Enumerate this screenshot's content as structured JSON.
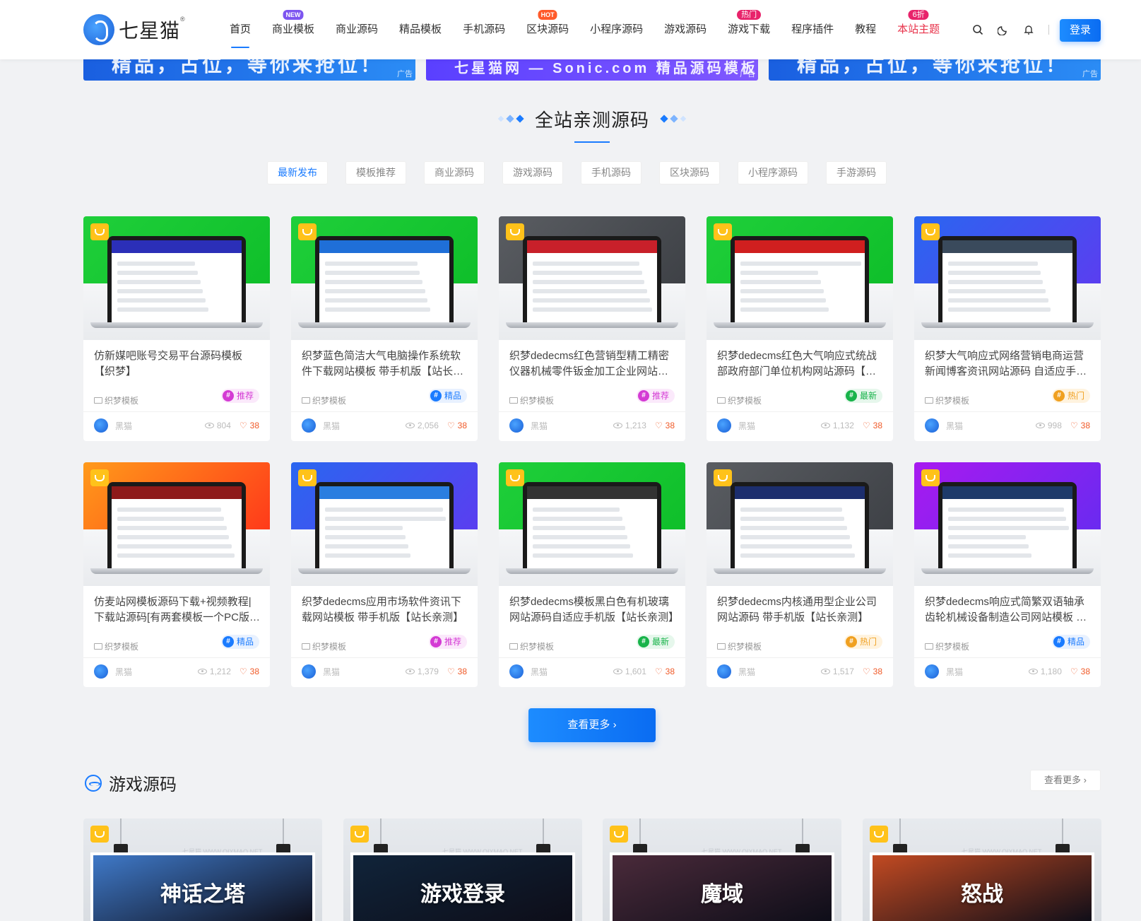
{
  "header": {
    "logo_text": "七星猫",
    "logo_reg": "®",
    "nav": [
      {
        "label": "首页",
        "badge": "",
        "active": true
      },
      {
        "label": "商业模板",
        "badge": "NEW",
        "badge_type": "new"
      },
      {
        "label": "商业源码",
        "badge": ""
      },
      {
        "label": "精品模板",
        "badge": ""
      },
      {
        "label": "手机源码",
        "badge": ""
      },
      {
        "label": "区块源码",
        "badge": "HOT",
        "badge_type": "hot"
      },
      {
        "label": "小程序源码",
        "badge": ""
      },
      {
        "label": "游戏源码",
        "badge": ""
      },
      {
        "label": "游戏下载",
        "badge": "热门",
        "badge_type": "pink"
      },
      {
        "label": "程序插件",
        "badge": ""
      },
      {
        "label": "教程",
        "badge": ""
      },
      {
        "label": "本站主题",
        "badge": "6折",
        "badge_type": "pink",
        "red": true
      }
    ],
    "icons": [
      "search-icon",
      "moon-icon",
      "bell-icon"
    ],
    "login_label": "登录"
  },
  "ads": [
    {
      "text": "精品，占位，等你来抢位！",
      "tag": "广告"
    },
    {
      "text": "七星猫网 — Sonic.com 精品源码模板",
      "tag": "广告"
    },
    {
      "text": "精品，占位，等你来抢位！",
      "tag": "广告"
    }
  ],
  "section": {
    "title": "全站亲测源码",
    "tabs": [
      "最新发布",
      "模板推荐",
      "商业源码",
      "游戏源码",
      "手机源码",
      "区块源码",
      "小程序源码",
      "手游源码"
    ]
  },
  "cards": [
    {
      "title": "仿新媒吧账号交易平台源码模板【织梦】",
      "category": "织梦模板",
      "tag": "推荐",
      "author": "黑猫",
      "views": "804",
      "likes": "38",
      "theme": "green",
      "screen": "#2b2fb8"
    },
    {
      "title": "织梦蓝色简洁大气电脑操作系统软件下载网站模板 带手机版【站长亲测】",
      "category": "织梦模板",
      "tag": "精品",
      "author": "黑猫",
      "views": "2,056",
      "likes": "38",
      "theme": "green",
      "screen": "#1f6fd8"
    },
    {
      "title": "织梦dedecms红色营销型精工精密仪器机械零件钣金加工企业网站模板",
      "category": "织梦模板",
      "tag": "推荐",
      "author": "黑猫",
      "views": "1,213",
      "likes": "38",
      "theme": "gray",
      "screen": "#c8202a"
    },
    {
      "title": "织梦dedecms红色大气响应式统战部政府部门单位机构网站源码【站长亲测】",
      "category": "织梦模板",
      "tag": "最新",
      "author": "黑猫",
      "views": "1,132",
      "likes": "38",
      "theme": "green",
      "screen": "#d01f1f"
    },
    {
      "title": "织梦大气响应式网络营销电商运营新闻博客资讯网站源码 自适应手机版",
      "category": "织梦模板",
      "tag": "热门",
      "author": "黑猫",
      "views": "998",
      "likes": "38",
      "theme": "blue",
      "screen": "#3a4a5c"
    },
    {
      "title": "仿麦站网模板源码下载+视频教程|下载站源码[有两套模板一个PC版一个手机版]",
      "category": "织梦模板",
      "tag": "精品",
      "author": "黑猫",
      "views": "1,212",
      "likes": "38",
      "theme": "orange",
      "screen": "#8e1a1a"
    },
    {
      "title": "织梦dedecms应用市场软件资讯下载网站模板 带手机版【站长亲测】",
      "category": "织梦模板",
      "tag": "推荐",
      "author": "黑猫",
      "views": "1,379",
      "likes": "38",
      "theme": "blue",
      "screen": "#2a7ee0"
    },
    {
      "title": "织梦dedecms模板黑白色有机玻璃网站源码自适应手机版【站长亲测】",
      "category": "织梦模板",
      "tag": "最新",
      "author": "黑猫",
      "views": "1,601",
      "likes": "38",
      "theme": "green",
      "screen": "#333333"
    },
    {
      "title": "织梦dedecms内核通用型企业公司网站源码 带手机版【站长亲测】",
      "category": "织梦模板",
      "tag": "热门",
      "author": "黑猫",
      "views": "1,517",
      "likes": "38",
      "theme": "gray",
      "screen": "#1c2e6e"
    },
    {
      "title": "织梦dedecms响应式简繁双语轴承齿轮机械设备制造公司网站模板 自适应手机版",
      "category": "织梦模板",
      "tag": "精品",
      "author": "黑猫",
      "views": "1,180",
      "likes": "38",
      "theme": "purple",
      "screen": "#1e3a6a"
    }
  ],
  "more_label": "查看更多 ›",
  "game_section": {
    "title": "游戏源码",
    "more_label": "查看更多 ›",
    "posters": [
      {
        "title": "神话之塔",
        "bg": "#3f79c8"
      },
      {
        "title": "游戏登录",
        "bg": "#10243a"
      },
      {
        "title": "魔域",
        "bg": "#4a2a3a"
      },
      {
        "title": "怒战",
        "bg": "#c24a22"
      }
    ],
    "watermark": "七星猫 WWW.QIXMAO.NET"
  },
  "colors": {
    "accent": "#1a7bff",
    "tag_推荐": "#d43bd4",
    "tag_精品": "#1a7bff",
    "tag_最新": "#18b34a",
    "tag_热门": "#f0a020"
  }
}
